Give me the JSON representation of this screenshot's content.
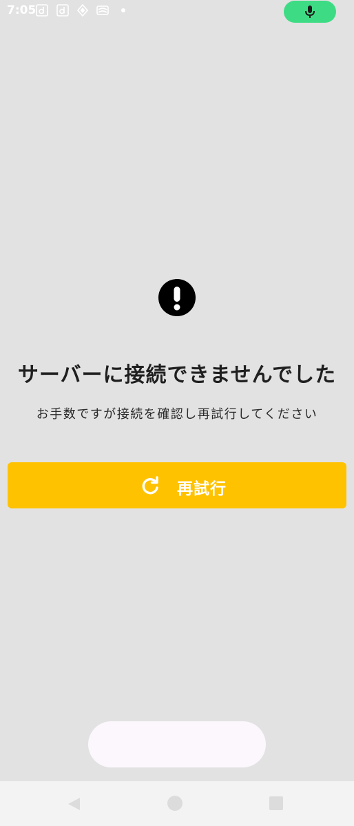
{
  "status_bar": {
    "time": "7:05",
    "icons": [
      "d-app-icon",
      "d-app-icon",
      "diamond-app-icon",
      "cast-icon",
      "dot-icon"
    ],
    "mic_indicator": "mic-icon",
    "mic_color": "#3ddc84"
  },
  "error": {
    "icon": "exclamation-circle-icon",
    "title": "サーバーに接続できませんでした",
    "message": "お手数ですが接続を確認し再試行してください"
  },
  "retry_button": {
    "label": "再試行",
    "icon": "refresh-icon",
    "color": "#ffc200"
  },
  "navigation": {
    "back": "back-triangle-icon",
    "home": "home-circle-icon",
    "recents": "recents-square-icon"
  }
}
